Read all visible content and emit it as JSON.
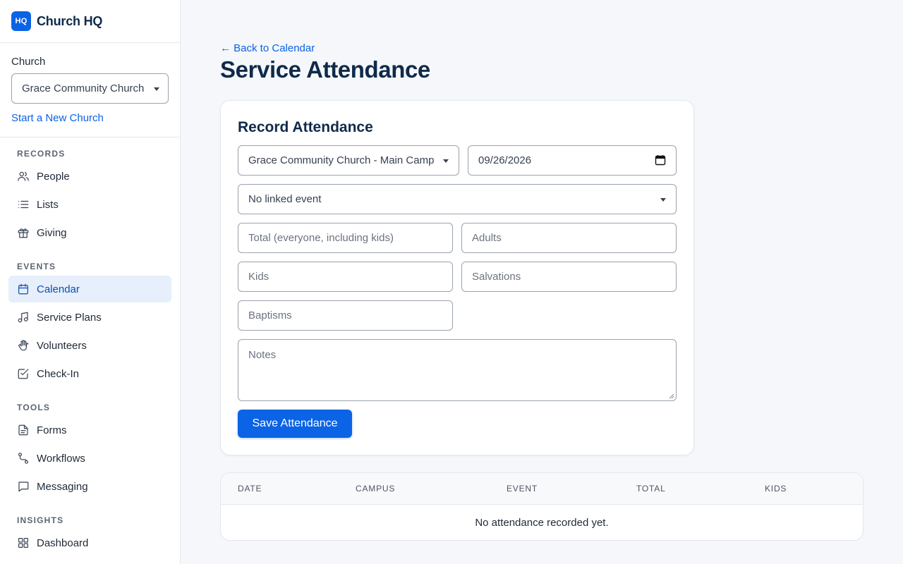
{
  "brand": {
    "logo": "HQ",
    "name": "Church HQ"
  },
  "church": {
    "label": "Church",
    "selected": "Grace Community Church",
    "new_link": "Start a New Church"
  },
  "nav": {
    "records": {
      "title": "RECORDS",
      "items": [
        {
          "label": "People",
          "icon": "people-icon"
        },
        {
          "label": "Lists",
          "icon": "list-icon"
        },
        {
          "label": "Giving",
          "icon": "gift-icon"
        }
      ]
    },
    "events": {
      "title": "EVENTS",
      "items": [
        {
          "label": "Calendar",
          "icon": "calendar-icon",
          "active": true
        },
        {
          "label": "Service Plans",
          "icon": "music-note-icon"
        },
        {
          "label": "Volunteers",
          "icon": "hand-icon"
        },
        {
          "label": "Check-In",
          "icon": "check-square-icon"
        }
      ]
    },
    "tools": {
      "title": "TOOLS",
      "items": [
        {
          "label": "Forms",
          "icon": "document-icon"
        },
        {
          "label": "Workflows",
          "icon": "workflow-icon"
        },
        {
          "label": "Messaging",
          "icon": "message-icon"
        }
      ]
    },
    "insights": {
      "title": "INSIGHTS",
      "items": [
        {
          "label": "Dashboard",
          "icon": "dashboard-icon"
        }
      ]
    }
  },
  "page": {
    "back_link": "← Back to Calendar",
    "title": "Service Attendance"
  },
  "form": {
    "title": "Record Attendance",
    "campus": "Grace Community Church - Main Campus",
    "date": "09/26/2026",
    "event": "No linked event",
    "total_placeholder": "Total (everyone, including kids)",
    "adults_placeholder": "Adults",
    "kids_placeholder": "Kids",
    "salvations_placeholder": "Salvations",
    "baptisms_placeholder": "Baptisms",
    "notes_placeholder": "Notes",
    "save_label": "Save Attendance"
  },
  "table": {
    "headers": [
      "DATE",
      "CAMPUS",
      "EVENT",
      "TOTAL",
      "KIDS"
    ],
    "empty": "No attendance recorded yet."
  },
  "colors": {
    "accent": "#0b63e5",
    "title": "#0f2a4a",
    "active_bg": "#e6effb"
  }
}
